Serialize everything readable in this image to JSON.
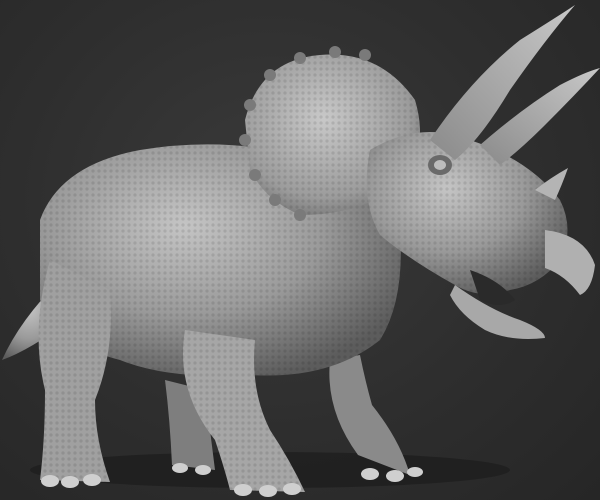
{
  "scene": {
    "subject": "triceratops-sculpt",
    "colors": {
      "background": "#2f2f2f",
      "body_light": "#b8b8b8",
      "body_mid": "#8f8f8f",
      "body_dark": "#5a5a5a",
      "shadow": "#1c1c1c"
    }
  }
}
